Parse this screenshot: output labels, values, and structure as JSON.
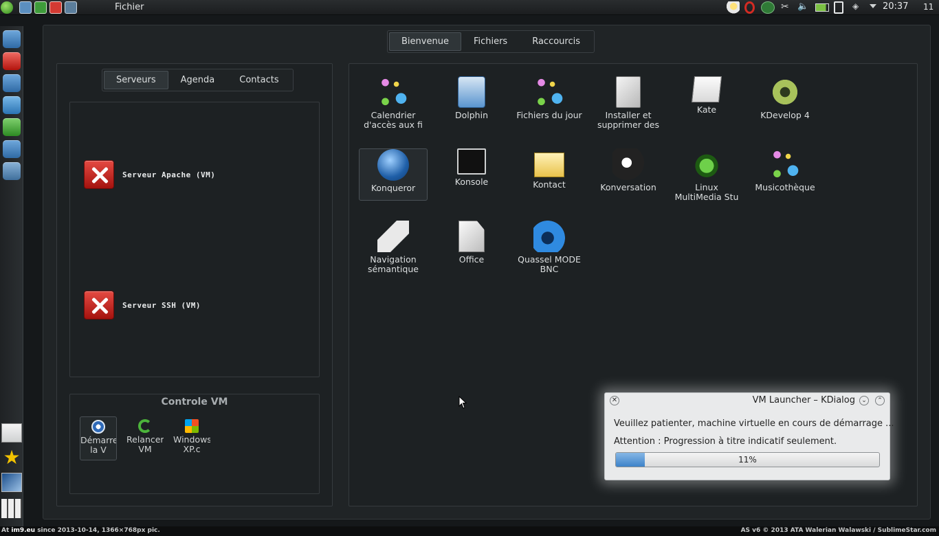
{
  "top_panel": {
    "menu_label": "Fichier",
    "clock": "20:37",
    "day": "11"
  },
  "dashboard": {
    "tabs": [
      {
        "label": "Bienvenue",
        "active": true
      },
      {
        "label": "Fichiers",
        "active": false
      },
      {
        "label": "Raccourcis",
        "active": false
      }
    ],
    "left_tabs": [
      {
        "label": "Serveurs",
        "active": true
      },
      {
        "label": "Agenda",
        "active": false
      },
      {
        "label": "Contacts",
        "active": false
      }
    ],
    "servers": [
      {
        "label": "Serveur Apache (VM)",
        "status_icon": "error-x-icon"
      },
      {
        "label": "Serveur SSH (VM)",
        "status_icon": "error-x-icon"
      }
    ],
    "vm_control": {
      "title": "Controle VM",
      "buttons": [
        {
          "label": "Démarrer la V",
          "icon": "play-icon"
        },
        {
          "label": "Relancer VM",
          "icon": "reload-icon"
        },
        {
          "label": "Windows XP.c",
          "icon": "windows-icon"
        }
      ]
    },
    "apps": [
      {
        "label": "Calendrier d'accès aux fi",
        "icon": "semantic-node-icon"
      },
      {
        "label": "Dolphin",
        "icon": "file-cabinet-icon"
      },
      {
        "label": "Fichiers du jour",
        "icon": "semantic-node-icon"
      },
      {
        "label": "Installer et supprimer des",
        "icon": "package-installer-icon"
      },
      {
        "label": "Kate",
        "icon": "text-editor-icon"
      },
      {
        "label": "KDevelop 4",
        "icon": "gear-kdevelop-icon"
      },
      {
        "label": "Konqueror",
        "icon": "globe-icon"
      },
      {
        "label": "Konsole",
        "icon": "terminal-icon"
      },
      {
        "label": "Kontact",
        "icon": "contact-envelope-icon"
      },
      {
        "label": "Konversation",
        "icon": "chat-megaphone-icon"
      },
      {
        "label": "Linux MultiMedia Stu",
        "icon": "lmms-music-icon"
      },
      {
        "label": "Musicothèque",
        "icon": "semantic-node-icon"
      },
      {
        "label": "Navigation sémantique",
        "icon": "tag-icon"
      },
      {
        "label": "Office",
        "icon": "document-icon"
      },
      {
        "label": "Quassel MODE BNC",
        "icon": "quassel-icon"
      }
    ]
  },
  "dialog": {
    "title": "VM Launcher – KDialog",
    "message": "Veuillez patienter, machine virtuelle en cours de démarrage ...",
    "note": "Attention : Progression à titre indicatif seulement.",
    "progress_text": "11%",
    "progress_value": 0.11
  },
  "bottom_bar": {
    "left_prefix": "At ",
    "left_site": "im9.eu",
    "left_rest": "since 2013-10-14, 1366×768px pic.",
    "right": "AS v6 © 2013 ATA Walerian Walawski / SublimeStar.com"
  },
  "colors": {
    "accent_blue": "#3d82c9",
    "error_red": "#c21c16",
    "background": "#15181a"
  }
}
